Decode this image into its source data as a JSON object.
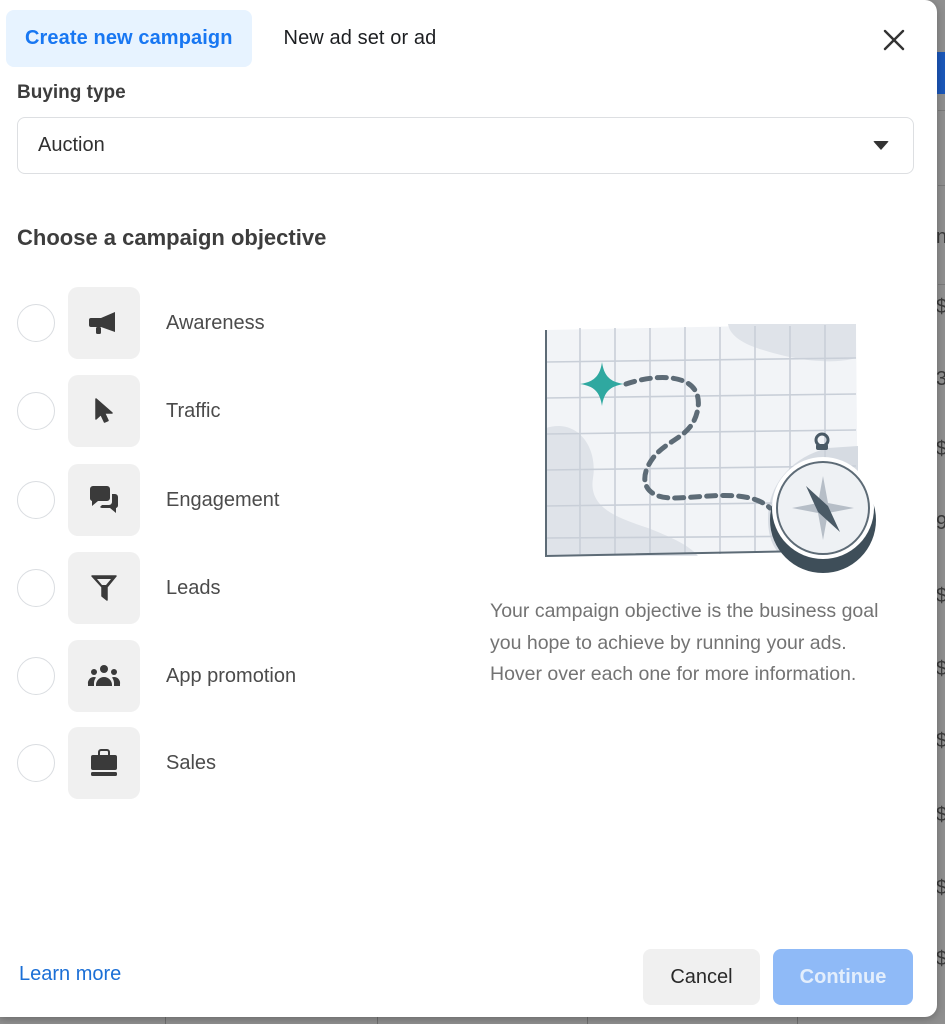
{
  "tabs": [
    {
      "label": "Create new campaign",
      "active": true
    },
    {
      "label": "New ad set or ad",
      "active": false
    }
  ],
  "buying_type": {
    "label": "Buying type",
    "selected": "Auction"
  },
  "objective_section": {
    "title": "Choose a campaign objective",
    "options": [
      {
        "label": "Awareness",
        "icon": "megaphone-icon",
        "selected": false
      },
      {
        "label": "Traffic",
        "icon": "cursor-icon",
        "selected": false
      },
      {
        "label": "Engagement",
        "icon": "chat-bubbles-icon",
        "selected": false
      },
      {
        "label": "Leads",
        "icon": "funnel-icon",
        "selected": false
      },
      {
        "label": "App promotion",
        "icon": "people-group-icon",
        "selected": false
      },
      {
        "label": "Sales",
        "icon": "shopping-bag-icon",
        "selected": false
      }
    ]
  },
  "description": "Your campaign objective is the business goal you hope to achieve by running your ads. Hover over each one for more information.",
  "footer": {
    "learn_more": "Learn more",
    "cancel": "Cancel",
    "continue": "Continue",
    "continue_disabled": true
  },
  "background_fragments": {
    "chars": [
      "n",
      "$",
      "3",
      "$",
      "9",
      "$",
      "$",
      "$",
      "$",
      "$",
      "$"
    ]
  },
  "colors": {
    "accent": "#1877f2",
    "active_tab_bg": "#e7f3ff",
    "continue_disabled_bg": "#8fbaf7",
    "illustration_teal": "#2fa8a0",
    "illustration_slate": "#4a5a66"
  }
}
